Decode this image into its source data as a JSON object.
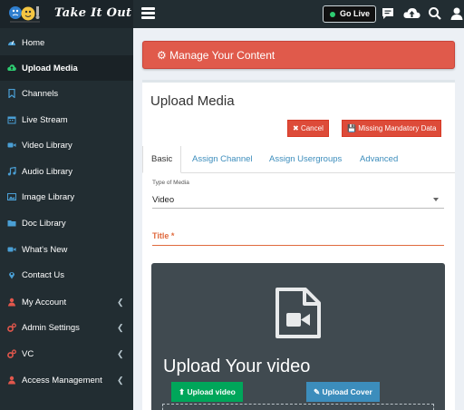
{
  "brand": {
    "name": "Take It Out"
  },
  "header": {
    "go_live_label": "Go Live"
  },
  "sidebar": {
    "items": [
      {
        "label": "Home",
        "icon": "dashboard-icon",
        "active": false,
        "has_chevron": false
      },
      {
        "label": "Upload Media",
        "icon": "cloud-upload-icon",
        "active": true,
        "has_chevron": false
      },
      {
        "label": "Channels",
        "icon": "bookmark-icon",
        "active": false,
        "has_chevron": false
      },
      {
        "label": "Live Stream",
        "icon": "calendar-icon",
        "active": false,
        "has_chevron": false
      },
      {
        "label": "Video Library",
        "icon": "video-camera-icon",
        "active": false,
        "has_chevron": false
      },
      {
        "label": "Audio Library",
        "icon": "music-note-icon",
        "active": false,
        "has_chevron": false
      },
      {
        "label": "Image Library",
        "icon": "image-icon",
        "active": false,
        "has_chevron": false
      },
      {
        "label": "Doc Library",
        "icon": "folder-icon",
        "active": false,
        "has_chevron": false
      },
      {
        "label": "What's New",
        "icon": "video-camera-icon",
        "active": false,
        "has_chevron": false
      },
      {
        "label": "Contact Us",
        "icon": "map-marker-icon",
        "active": false,
        "has_chevron": false
      },
      {
        "label": "My Account",
        "icon": "user-icon",
        "active": false,
        "has_chevron": true
      },
      {
        "label": "Admin Settings",
        "icon": "cogs-icon",
        "active": false,
        "has_chevron": true
      },
      {
        "label": "VC",
        "icon": "cogs-icon",
        "active": false,
        "has_chevron": true
      },
      {
        "label": "Access Management",
        "icon": "user-icon",
        "active": false,
        "has_chevron": true
      }
    ]
  },
  "manage": {
    "title": "Manage Your Content"
  },
  "panel": {
    "title": "Upload Media",
    "cancel_label": "Cancel",
    "missing_label": "Missing Mandatory Data"
  },
  "tabs": [
    {
      "label": "Basic",
      "active": true
    },
    {
      "label": "Assign Channel",
      "active": false
    },
    {
      "label": "Assign Usergroups",
      "active": false
    },
    {
      "label": "Advanced",
      "active": false
    }
  ],
  "form": {
    "type_label": "Type of Media",
    "type_value": "Video",
    "title_label": "Title *"
  },
  "upload": {
    "heading": "Upload Your video",
    "upload_video_label": "Upload video",
    "upload_cover_label": "Upload Cover"
  },
  "colors": {
    "sidebar_bg": "#222d32",
    "manage_bar": "#e05a4b",
    "btn_red": "#dd4b39",
    "btn_green": "#00a65a",
    "btn_blue": "#3c8dbc",
    "title_accent": "#e06a3e"
  }
}
